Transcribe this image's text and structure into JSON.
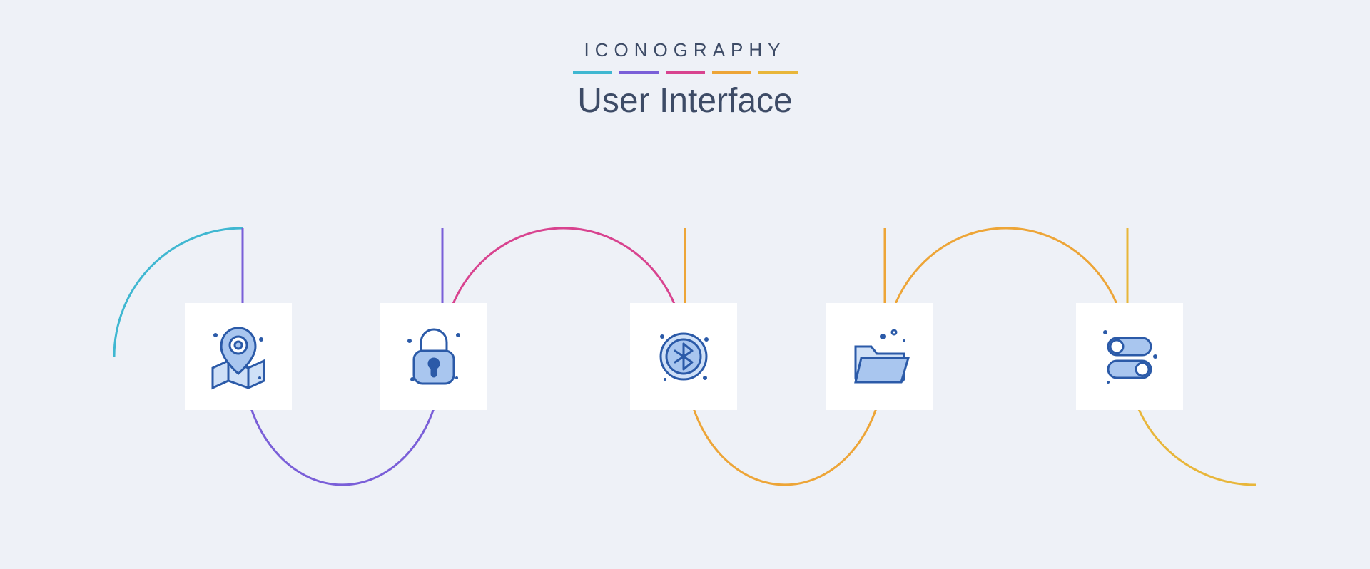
{
  "header": {
    "kicker": "ICONOGRAPHY",
    "title": "User Interface"
  },
  "accent_colors": [
    "#3fb7d1",
    "#7a5fd8",
    "#d8438f",
    "#eda537",
    "#e8b63a"
  ],
  "wave_colors": {
    "segment1": "#3fb7d1",
    "segment2": "#7a5fd8",
    "segment3": "#d8438f",
    "segment4": "#eda537",
    "segment5": "#e8b63a"
  },
  "icons": [
    {
      "name": "map-pin-icon",
      "label": "Location"
    },
    {
      "name": "lock-icon",
      "label": "Lock"
    },
    {
      "name": "bluetooth-icon",
      "label": "Bluetooth"
    },
    {
      "name": "folder-icon",
      "label": "Folder"
    },
    {
      "name": "toggle-icon",
      "label": "Toggle switches"
    }
  ]
}
